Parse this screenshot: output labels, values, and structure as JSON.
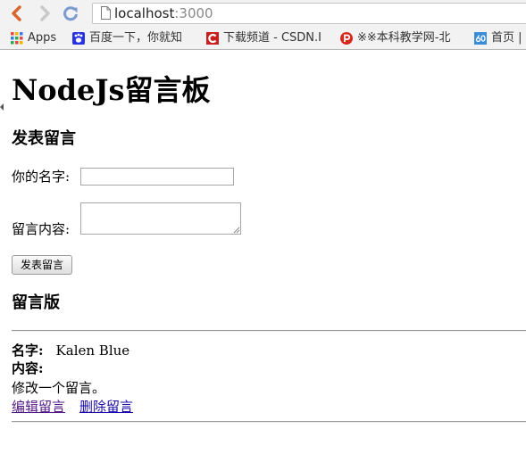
{
  "browser": {
    "url_host": "localhost",
    "url_port": ":3000",
    "bookmarks": [
      {
        "label": "Apps",
        "icon": "apps-grid-icon"
      },
      {
        "label": "百度一下，你就知",
        "icon": "baidu-paw-icon"
      },
      {
        "label": "下载频道 - CSDN.I",
        "icon": "csdn-icon"
      },
      {
        "label": "※※本科教学网-北",
        "icon": "p-logo-icon"
      },
      {
        "label": "首页 |",
        "icon": "number-60-icon"
      }
    ]
  },
  "page": {
    "title": "NodeJs留言板",
    "form": {
      "heading": "发表留言",
      "name_label": "你的名字:",
      "name_value": "",
      "content_label": "留言内容:",
      "content_value": "",
      "submit_label": "发表留言"
    },
    "board": {
      "heading": "留言版",
      "messages": [
        {
          "name_label": "名字:",
          "name": "Kalen Blue",
          "content_label": "内容:",
          "content": "修改一个留言。",
          "edit_label": "编辑留言",
          "delete_label": "删除留言"
        }
      ]
    }
  },
  "colors": {
    "link": "#1a0dab",
    "visited_link": "#551a8b",
    "csdn_red": "#c8201f",
    "baidu_blue": "#2932e1"
  }
}
